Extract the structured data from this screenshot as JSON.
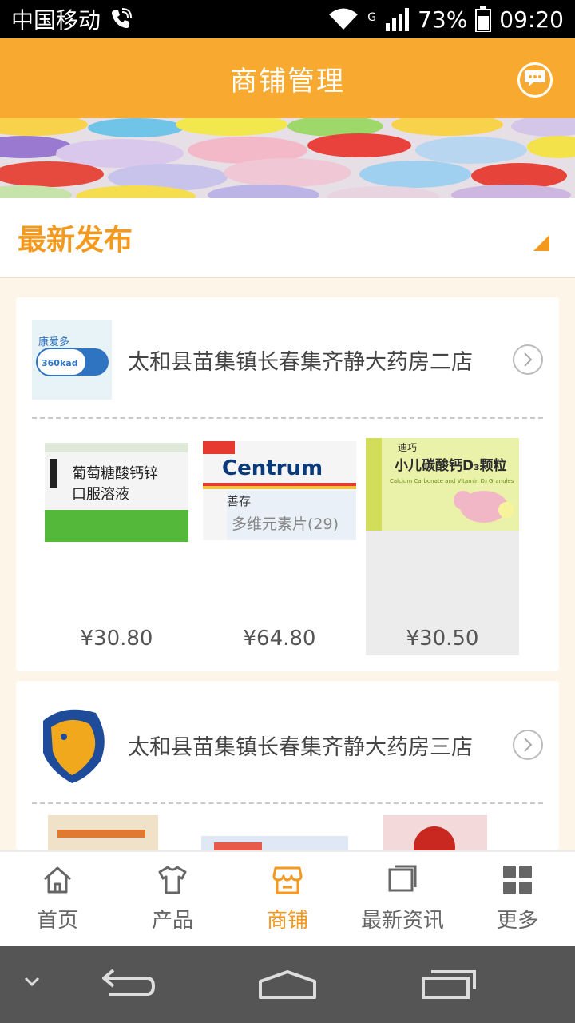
{
  "status_bar": {
    "carrier": "中国移动",
    "network": "G",
    "battery": "73%",
    "time": "09:20"
  },
  "header": {
    "title": "商铺管理",
    "message_icon": "chat-bubble-icon"
  },
  "section": {
    "title": "最新发布"
  },
  "stores": [
    {
      "name": "太和县苗集镇长春集齐静大药房二店",
      "logo_text": "康爱多",
      "logo_sub": "360kad",
      "products": [
        {
          "price": "¥30.80",
          "line1": "葡萄糖酸钙锌",
          "line2": "口服溶液",
          "selected": false
        },
        {
          "price": "¥64.80",
          "line1": "Centrum",
          "line2": "多维元素片(29)",
          "badge": "善存",
          "selected": false
        },
        {
          "price": "¥30.50",
          "line1": "小儿碳酸钙D₃颗粒",
          "line2": "Calcium Carbonate and Vitamin D₃ Granules",
          "badge": "迪巧",
          "selected": true
        }
      ]
    },
    {
      "name": "太和县苗集镇长春集齐静大药房三店",
      "logo_text": "",
      "products": []
    }
  ],
  "bottom_nav": [
    {
      "label": "首页",
      "icon": "home-icon",
      "active": false
    },
    {
      "label": "产品",
      "icon": "shirt-icon",
      "active": false
    },
    {
      "label": "商铺",
      "icon": "store-icon",
      "active": true
    },
    {
      "label": "最新资讯",
      "icon": "news-icon",
      "active": false
    },
    {
      "label": "更多",
      "icon": "grid-icon",
      "active": false
    }
  ],
  "colors": {
    "accent": "#f8a92f",
    "accent_text": "#f3991d"
  }
}
